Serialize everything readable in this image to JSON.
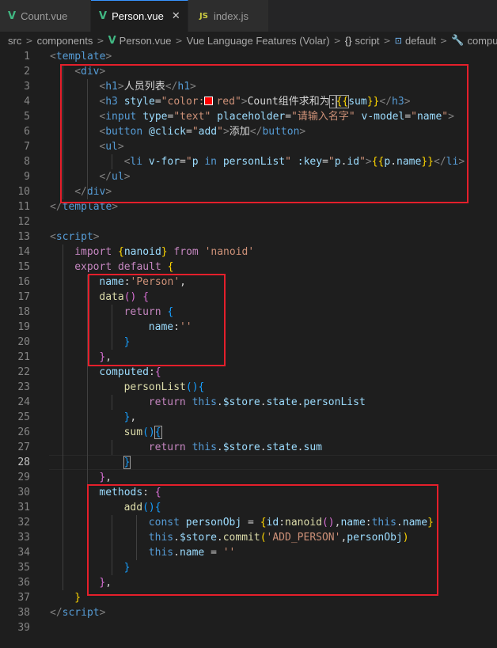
{
  "tabs": [
    {
      "icon": "V",
      "label": "Count.vue",
      "active": false
    },
    {
      "icon": "V",
      "label": "Person.vue",
      "active": true,
      "close": "✕"
    },
    {
      "icon": "JS",
      "label": "index.js",
      "active": false
    }
  ],
  "breadcrumbs": [
    "src",
    "components",
    "Person.vue",
    "Vue Language Features (Volar)",
    "script",
    "default",
    "compute"
  ],
  "breadcrumb_icons": {
    "script": "{}",
    "default": "⊡",
    "compute": "🔧"
  },
  "line_numbers": [
    "1",
    "2",
    "3",
    "4",
    "5",
    "6",
    "7",
    "8",
    "9",
    "10",
    "11",
    "12",
    "13",
    "14",
    "15",
    "16",
    "17",
    "18",
    "19",
    "20",
    "21",
    "22",
    "23",
    "24",
    "25",
    "26",
    "27",
    "28",
    "29",
    "30",
    "31",
    "32",
    "33",
    "34",
    "35",
    "36",
    "37",
    "38",
    "39"
  ],
  "active_line": "28",
  "code": {
    "l1": [
      "<",
      "template",
      ">"
    ],
    "l2": [
      "<",
      "div",
      ">"
    ],
    "l3": [
      "<",
      "h1",
      ">",
      "人员列表",
      "</",
      "h1",
      ">"
    ],
    "l4": [
      "<",
      "h3",
      " ",
      "style",
      "=",
      "\"color:",
      "red\"",
      ">",
      "Count组件求和为",
      ":",
      "{{",
      "sum",
      "}}",
      "</",
      "h3",
      ">"
    ],
    "l5": [
      "<",
      "input",
      " ",
      "type",
      "=",
      "\"text\"",
      " ",
      "placeholder",
      "=",
      "\"请输入名字\"",
      " ",
      "v-model",
      "=",
      "\"",
      "name",
      "\"",
      ">"
    ],
    "l6": [
      "<",
      "button",
      " ",
      "@click",
      "=",
      "\"",
      "add",
      "\"",
      ">",
      "添加",
      "</",
      "button",
      ">"
    ],
    "l7": [
      "<",
      "ul",
      ">"
    ],
    "l8": [
      "<",
      "li",
      " ",
      "v-for",
      "=",
      "\"",
      "p",
      " in ",
      "personList",
      "\"",
      " ",
      ":key",
      "=",
      "\"",
      "p",
      ".",
      "id",
      "\"",
      ">",
      "{{",
      "p",
      ".",
      "name",
      "}}",
      "</",
      "li",
      ">"
    ],
    "l9": [
      "</",
      "ul",
      ">"
    ],
    "l10": [
      "</",
      "div",
      ">"
    ],
    "l11": [
      "</",
      "template",
      ">"
    ],
    "l13": [
      "<",
      "script",
      ">"
    ],
    "l14": [
      "import",
      " ",
      "{",
      "nanoid",
      "}",
      " from ",
      "'nanoid'"
    ],
    "l15": [
      "export",
      " ",
      "default",
      " ",
      "{"
    ],
    "l16": [
      "name",
      ":",
      "'Person'",
      ","
    ],
    "l17": [
      "data",
      "()",
      " ",
      "{"
    ],
    "l18": [
      "return",
      " ",
      "{"
    ],
    "l19": [
      "name",
      ":",
      "''"
    ],
    "l20": [
      "}"
    ],
    "l21": [
      "}",
      ","
    ],
    "l22": [
      "computed",
      ":",
      "{"
    ],
    "l23": [
      "personList",
      "()",
      "{"
    ],
    "l24": [
      "return",
      " ",
      "this",
      ".",
      "$store",
      ".",
      "state",
      ".",
      "personList"
    ],
    "l25": [
      "}",
      ","
    ],
    "l26": [
      "sum",
      "()",
      "{"
    ],
    "l27": [
      "return",
      " ",
      "this",
      ".",
      "$store",
      ".",
      "state",
      ".",
      "sum"
    ],
    "l28": [
      "}"
    ],
    "l29": [
      "}",
      ","
    ],
    "l30": [
      "methods",
      ":",
      " ",
      "{"
    ],
    "l31": [
      "add",
      "()",
      "{"
    ],
    "l32": [
      "const",
      " ",
      "personObj",
      " = ",
      "{",
      "id",
      ":",
      "nanoid",
      "()",
      ",",
      "name",
      ":",
      "this",
      ".",
      "name",
      "}"
    ],
    "l33": [
      "this",
      ".",
      "$store",
      ".",
      "commit",
      "(",
      "'ADD_PERSON'",
      ",",
      "personObj",
      ")"
    ],
    "l34": [
      "this",
      ".",
      "name",
      " = ",
      "''"
    ],
    "l35": [
      "}"
    ],
    "l36": [
      "}",
      ","
    ],
    "l37": [
      "}"
    ],
    "l38": [
      "</",
      "script",
      ">"
    ]
  },
  "colors": {
    "highlight_box": "#e51f2b",
    "background": "#1e1e1e",
    "tag": "#569cd6",
    "attribute": "#9cdcfe",
    "string": "#ce9178",
    "keyword": "#c586c0"
  }
}
